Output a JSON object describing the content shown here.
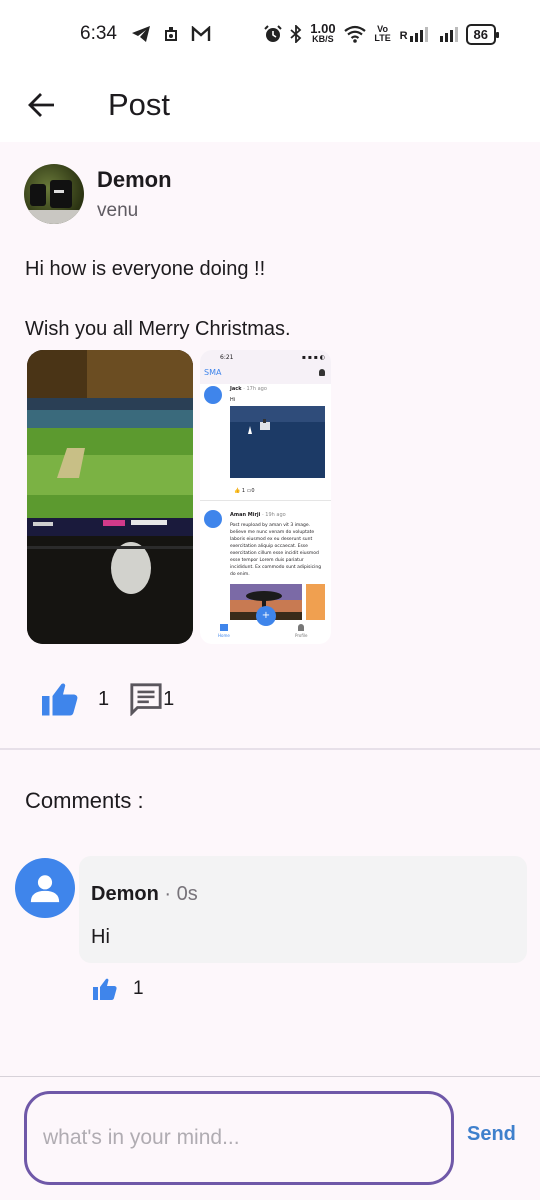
{
  "status_bar": {
    "time": "6:34",
    "net_speed": "1.00",
    "net_unit": "KB/S",
    "volte": "Vo LTE",
    "signal_r": "R",
    "battery": "86"
  },
  "app_bar": {
    "title": "Post"
  },
  "post": {
    "author_name": "Demon",
    "author_handle": "venu",
    "text": "Hi how is everyone doing !!\n\nWish you all Merry Christmas.",
    "likes": "1",
    "comments": "1",
    "screenshot": {
      "time": "6:21",
      "app_name": "SMA",
      "post1_author": "Jack",
      "post1_time": "· 17h ago",
      "post1_text": "Hi",
      "post1_likes": "1",
      "post1_comments": "0",
      "post2_author": "Aman Mirji",
      "post2_time": "· 19h ago",
      "post2_text": "Post  reupload by aman vit 3 image. believe me nunc venam do voluptate laboris eiusmod ex eu deserunt sunt exercitation aliquip occaecat. Esse exercitation cillum esse incidit eiusmod esse tempor Lorem duis pariatur incididunt. Ex commodo sunt adipisicing do enim.",
      "nav_home": "Home",
      "nav_profile": "Profile"
    }
  },
  "comments_section": {
    "title": "Comments :",
    "items": [
      {
        "author": "Demon",
        "time": "· 0s",
        "text": "Hi",
        "likes": "1"
      }
    ]
  },
  "input": {
    "placeholder": "what's in your mind...",
    "send_label": "Send"
  },
  "colors": {
    "accent_blue": "#3f85eb",
    "input_border": "#6f58a8",
    "send_blue": "#3f80cc"
  }
}
